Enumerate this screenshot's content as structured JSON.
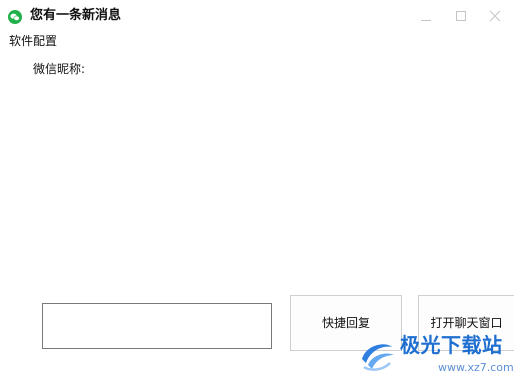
{
  "window": {
    "title": "您有一条新消息",
    "icon": "wechat-icon",
    "controls": [
      "minimize-icon",
      "maximize-icon",
      "close-icon"
    ]
  },
  "menu": {
    "settings_label": "软件配置"
  },
  "content": {
    "nickname_label": "微信昵称:"
  },
  "reply_input": {
    "value": "",
    "placeholder": ""
  },
  "buttons": {
    "quick_reply": "快捷回复",
    "open_chat": "打开聊天窗口"
  },
  "watermark": {
    "site_name": "极光下载站",
    "url": "www.xz7.com"
  },
  "colors": {
    "wechat_green": "#22b04b",
    "watermark_blue": "#1e6fd0"
  }
}
